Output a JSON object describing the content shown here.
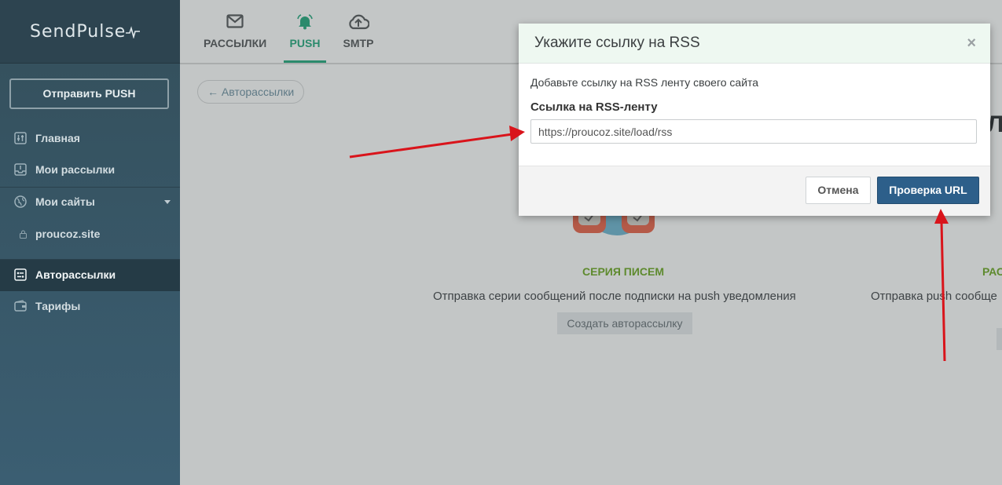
{
  "brand": {
    "name": "SendPulse"
  },
  "topnav": {
    "tabs": [
      {
        "label": "РАССЫЛКИ",
        "icon": "envelope-icon"
      },
      {
        "label": "PUSH",
        "icon": "bell-icon",
        "active": true
      },
      {
        "label": "SMTP",
        "icon": "cloud-upload-icon"
      }
    ]
  },
  "sidebar": {
    "send_button": "Отправить PUSH",
    "items": [
      {
        "label": "Главная",
        "icon": "sliders-icon"
      },
      {
        "label": "Мои рассылки",
        "icon": "inbox-icon"
      },
      {
        "label": "Мои сайты",
        "icon": "globe-icon"
      },
      {
        "label": "proucoz.site",
        "icon": "lock-icon"
      },
      {
        "label": "Авторассылки",
        "icon": "automation-icon",
        "active": true
      },
      {
        "label": "Тарифы",
        "icon": "wallet-icon"
      }
    ]
  },
  "main": {
    "back_link": "← Авторассылки",
    "card1": {
      "title": "СЕРИЯ ПИСЕМ",
      "description": "Отправка серии сообщений после подписки на push уведомления",
      "button": "Создать авторассылку"
    },
    "card2": {
      "title": "РАС",
      "description": "Отправка push сообще"
    },
    "partial_heading": "Л"
  },
  "modal": {
    "title": "Укажите ссылку на RSS",
    "close": "×",
    "text": "Добавьте ссылку на RSS ленту своего сайта",
    "field_label": "Ссылка на RSS-ленту",
    "field_value": "https://proucoz.site/load/rss",
    "cancel": "Отмена",
    "submit": "Проверка URL"
  },
  "colors": {
    "accent": "#2b8a6c",
    "primary_button": "#2d5f8a",
    "annotation_arrow": "#d9141b",
    "card_title": "#5e8a2e"
  }
}
